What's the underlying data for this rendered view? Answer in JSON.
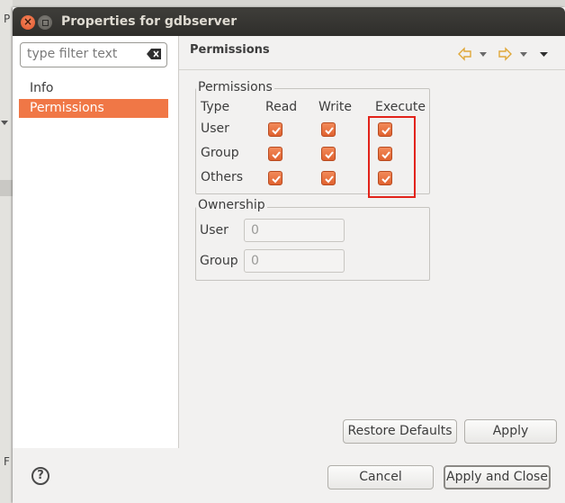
{
  "background_app": {
    "fragments": [
      "P",
      "F"
    ]
  },
  "window": {
    "title": "Properties for gdbserver"
  },
  "sidebar": {
    "filter_placeholder": "type filter text",
    "items": [
      {
        "label": "Info",
        "selected": false
      },
      {
        "label": "Permissions",
        "selected": true
      }
    ]
  },
  "page": {
    "title": "Permissions",
    "permissions": {
      "group_label": "Permissions",
      "headers": {
        "type": "Type",
        "read": "Read",
        "write": "Write",
        "execute": "Execute"
      },
      "rows": [
        {
          "type": "User",
          "read": true,
          "write": true,
          "execute": true
        },
        {
          "type": "Group",
          "read": true,
          "write": true,
          "execute": true
        },
        {
          "type": "Others",
          "read": true,
          "write": true,
          "execute": true
        }
      ]
    },
    "ownership": {
      "group_label": "Ownership",
      "user_label": "User",
      "user_value": "0",
      "group_label_field": "Group",
      "group_value": "0"
    }
  },
  "buttons": {
    "restore_defaults": "Restore Defaults",
    "apply": "Apply",
    "cancel": "Cancel",
    "apply_and_close": "Apply and Close",
    "help": "?"
  },
  "colors": {
    "accent": "#f07746",
    "highlight": "#e2231a"
  }
}
